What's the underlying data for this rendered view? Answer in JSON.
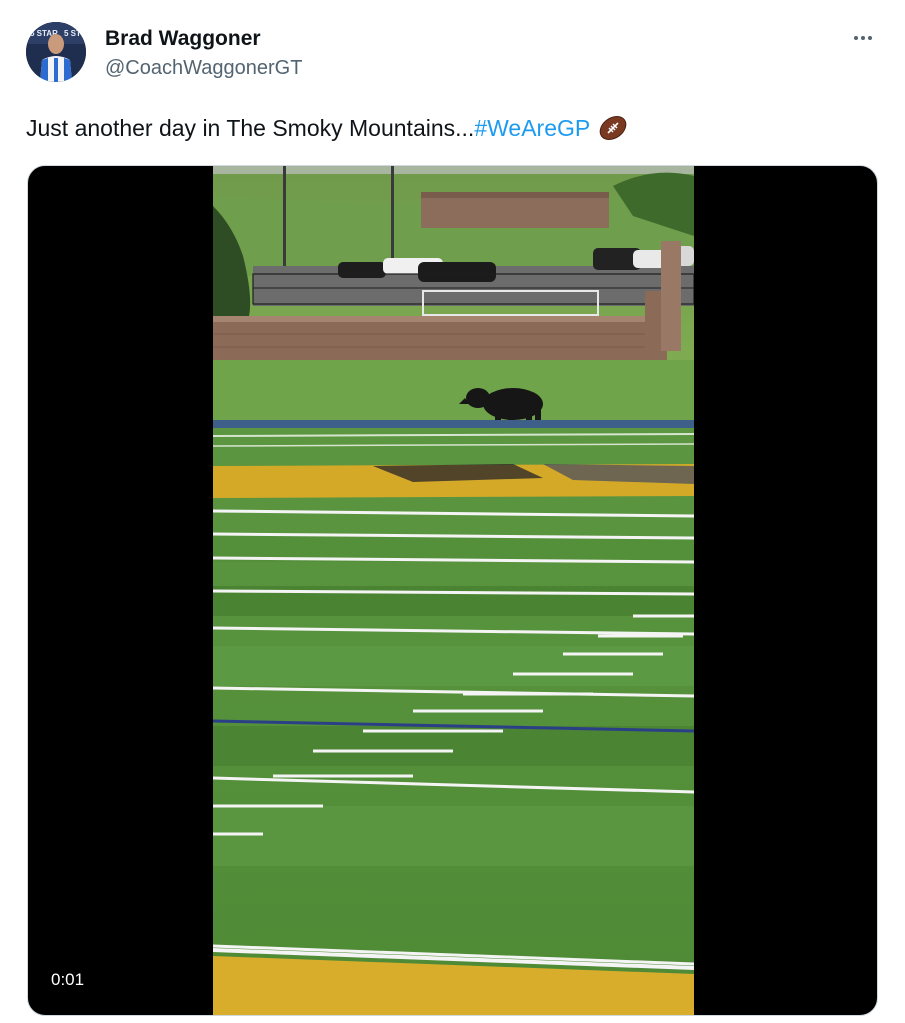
{
  "author": {
    "display_name": "Brad Waggoner",
    "handle": "@CoachWaggonerGT",
    "avatar_icon": "avatar-coach"
  },
  "more_icon": "more-horizontal-icon",
  "tweet": {
    "text": "Just another day in The Smoky Mountains...",
    "hashtag": "#WeAreGP",
    "emoji": "football-emoji"
  },
  "media": {
    "type": "video",
    "timestamp": "0:01"
  },
  "colors": {
    "text": "#0f1419",
    "secondary": "#536471",
    "link": "#1d9bf0",
    "border": "#cfd9de"
  }
}
